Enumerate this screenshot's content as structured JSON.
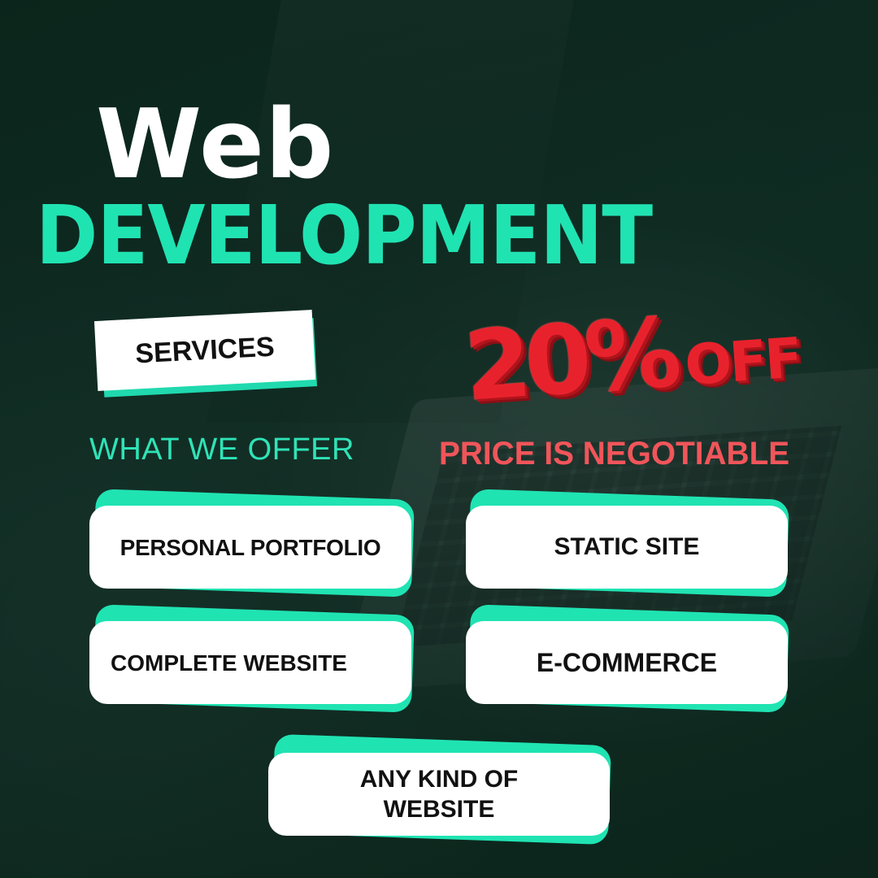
{
  "colors": {
    "background": "#0f2a20",
    "accent_green": "#20e3b2",
    "offer_green": "#2fe3b7",
    "discount_red": "#e8222c",
    "negotiable_red": "#f0555a",
    "card_white": "#ffffff",
    "card_text": "#111111"
  },
  "headline": {
    "line1": "Web",
    "line2": "DEVELOPMENT"
  },
  "services_tag": "SERVICES",
  "offer_label": "WHAT WE OFFER",
  "discount": {
    "amount": "20%",
    "suffix": "OFF"
  },
  "negotiable_note": "PRICE IS NEGOTIABLE",
  "services": [
    "PERSONAL PORTFOLIO",
    "STATIC SITE",
    "COMPLETE WEBSITE",
    "E-COMMERCE",
    "ANY KIND OF WEBSITE"
  ]
}
